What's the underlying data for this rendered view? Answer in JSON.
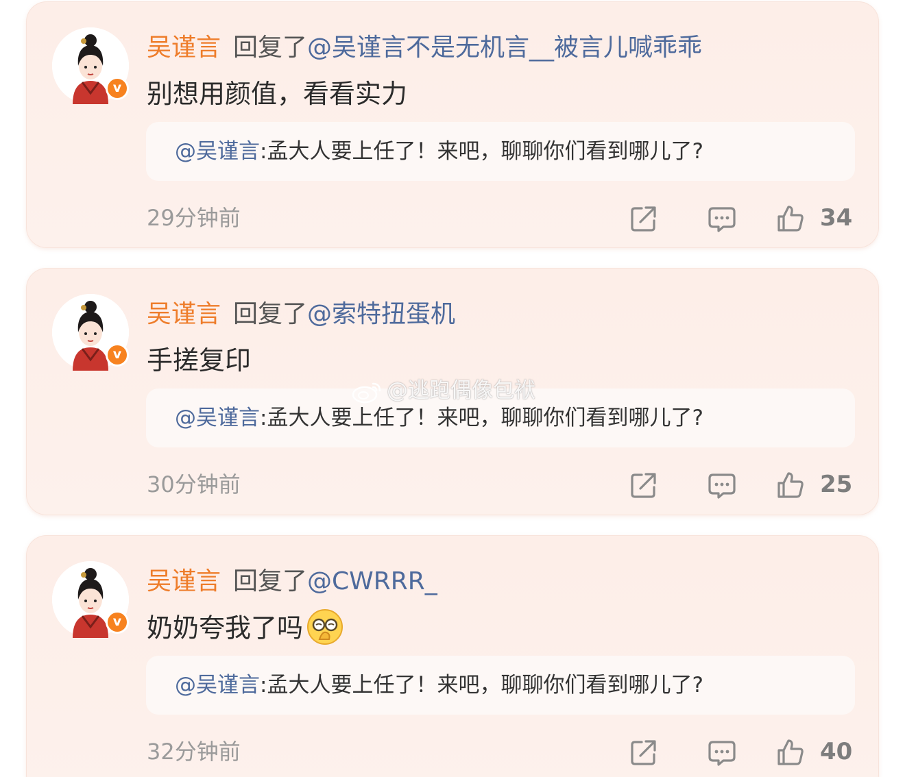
{
  "comments": [
    {
      "username": "吴谨言",
      "reply_word": "回复了",
      "reply_to": "@吴谨言不是无机言__被言儿喊乖乖",
      "text": "别想用颜值，看看实力",
      "quote_mention": "@吴谨言",
      "quote_text": ":孟大人要上任了！来吧，聊聊你们看到哪儿了?",
      "time": "29分钟前",
      "likes": "34",
      "verified_badge": "v"
    },
    {
      "username": "吴谨言",
      "reply_word": "回复了",
      "reply_to": "@索特扭蛋机",
      "text": "手搓复印",
      "quote_mention": "@吴谨言",
      "quote_text": ":孟大人要上任了！来吧，聊聊你们看到哪儿了?",
      "time": "30分钟前",
      "likes": "25",
      "verified_badge": "v"
    },
    {
      "username": "吴谨言",
      "reply_word": "回复了",
      "reply_to": "@CWRRR_",
      "text": "奶奶夸我了吗",
      "quote_mention": "@吴谨言",
      "quote_text": ":孟大人要上任了！来吧，聊聊你们看到哪儿了?",
      "time": "32分钟前",
      "likes": "40",
      "verified_badge": "v"
    }
  ],
  "watermark": "@逃跑偶像包袱",
  "icons": {
    "share": "share-icon",
    "comment": "comment-icon",
    "like": "thumbs-up-icon",
    "emoji": "shy-glasses-face-emoji-icon"
  },
  "colors": {
    "username": "#ee7d2b",
    "mention": "#4e6a9c",
    "badge": "#f7821f",
    "card_bg": "#fdeee8"
  }
}
